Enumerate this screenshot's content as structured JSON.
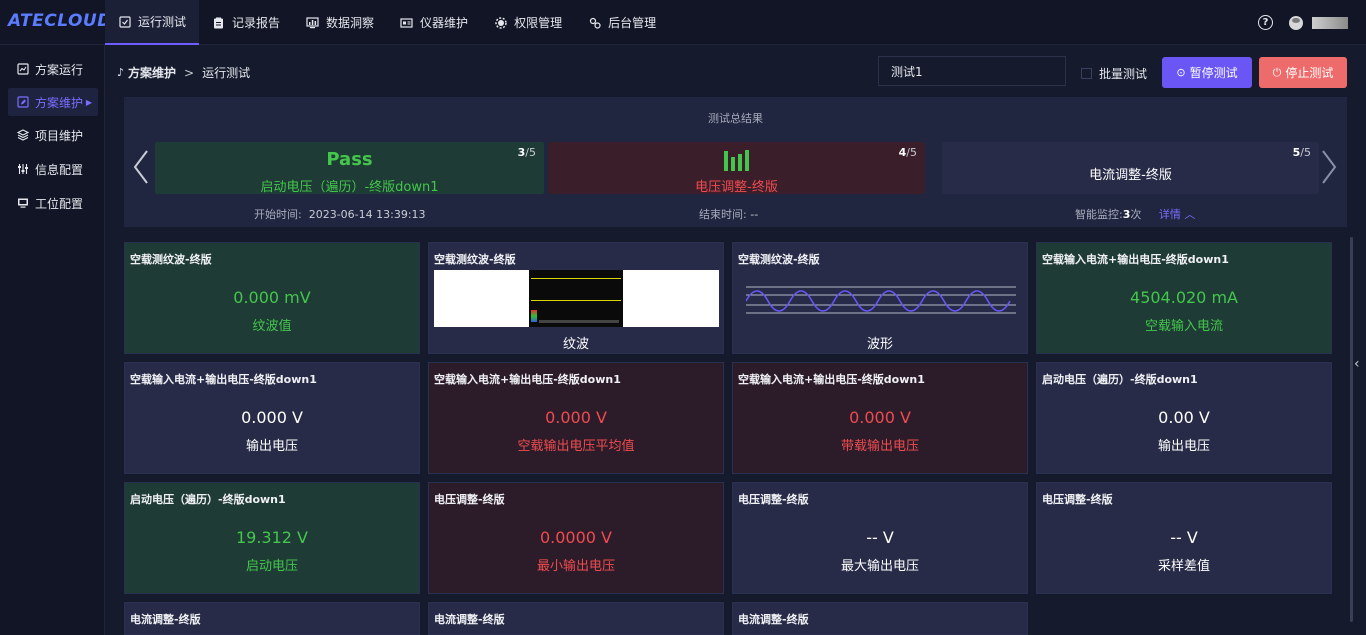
{
  "app": {
    "logo": "ATECLOUD"
  },
  "topnav": [
    {
      "label": "运行测试",
      "icon": "run-test-icon",
      "active": true
    },
    {
      "label": "记录报告",
      "icon": "report-icon"
    },
    {
      "label": "数据洞察",
      "icon": "data-insight-icon"
    },
    {
      "label": "仪器维护",
      "icon": "instrument-icon"
    },
    {
      "label": "权限管理",
      "icon": "permission-icon"
    },
    {
      "label": "后台管理",
      "icon": "admin-icon"
    }
  ],
  "sidebar": [
    {
      "label": "方案运行",
      "icon": "chart-icon"
    },
    {
      "label": "方案维护",
      "icon": "edit-icon",
      "active": true
    },
    {
      "label": "项目维护",
      "icon": "layers-icon"
    },
    {
      "label": "信息配置",
      "icon": "sliders-icon"
    },
    {
      "label": "工位配置",
      "icon": "monitor-icon"
    }
  ],
  "breadcrumb": {
    "parent": "方案维护",
    "current": "运行测试"
  },
  "toolbar": {
    "test_name": "测试1",
    "batch_label": "批量测试",
    "pause_label": "暂停测试",
    "stop_label": "停止测试"
  },
  "summary": {
    "title": "测试总结果",
    "cards": [
      {
        "big": "Pass",
        "sub": "启动电压（遍历）-终版down1",
        "current": "3",
        "total": "/5"
      },
      {
        "sub": "电压调整-终版",
        "current": "4",
        "total": "/5"
      },
      {
        "sub": "电流调整-终版",
        "current": "5",
        "total": "/5"
      }
    ],
    "start_label": "开始时间:",
    "start_value": "2023-06-14 13:39:13",
    "end_label": "结束时间:",
    "end_value": "--",
    "monitor_label": "智能监控:",
    "monitor_count": "3",
    "monitor_unit": "次",
    "detail_label": "详情"
  },
  "cards": [
    {
      "title": "空载测纹波-终版",
      "value": "0.000  mV",
      "label": "纹波值",
      "status": "green"
    },
    {
      "title": "空载测纹波-终版",
      "value": "",
      "label": "纹波",
      "status": "blue",
      "kind": "screenshot"
    },
    {
      "title": "空载测纹波-终版",
      "value": "",
      "label": "波形",
      "status": "blue",
      "kind": "wave"
    },
    {
      "title": "空载输入电流+输出电压-终版down1",
      "value": "4504.020  mA",
      "label": "空载输入电流",
      "status": "green"
    },
    {
      "title": "空载输入电流+输出电压-终版down1",
      "value": "0.000  V",
      "label": "输出电压",
      "status": "blue"
    },
    {
      "title": "空载输入电流+输出电压-终版down1",
      "value": "0.000  V",
      "label": "空载输出电压平均值",
      "status": "red"
    },
    {
      "title": "空载输入电流+输出电压-终版down1",
      "value": "0.000  V",
      "label": "带载输出电压",
      "status": "red"
    },
    {
      "title": "启动电压（遍历）-终版down1",
      "value": "0.00  V",
      "label": "输出电压",
      "status": "blue"
    },
    {
      "title": "启动电压（遍历）-终版down1",
      "value": "19.312  V",
      "label": "启动电压",
      "status": "green"
    },
    {
      "title": "电压调整-终版",
      "value": "0.0000  V",
      "label": "最小输出电压",
      "status": "red"
    },
    {
      "title": "电压调整-终版",
      "value": "--  V",
      "label": "最大输出电压",
      "status": "blue"
    },
    {
      "title": "电压调整-终版",
      "value": "--  V",
      "label": "采样差值",
      "status": "blue"
    },
    {
      "title": "电流调整-终版",
      "value": "",
      "label": "",
      "status": "blue"
    },
    {
      "title": "电流调整-终版",
      "value": "",
      "label": "",
      "status": "blue"
    },
    {
      "title": "电流调整-终版",
      "value": "",
      "label": "",
      "status": "blue"
    }
  ],
  "colors": {
    "accent": "#6a56f5",
    "stop": "#ed6b6b",
    "pass_green": "#44c64c",
    "fail_red": "#ef4b4f",
    "brand": "#5b7cff"
  }
}
